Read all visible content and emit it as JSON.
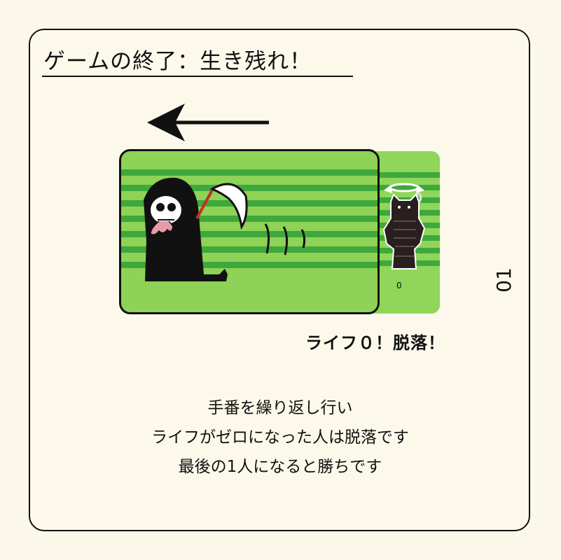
{
  "title": "ゲームの終了：生き残れ！",
  "caption": "ライフ０！脱落！",
  "page_number": "01",
  "body": {
    "lines": [
      "手番を繰り返し行い",
      "ライフがゼロになった人は脱落です",
      "最後の1人になると勝ちです"
    ]
  },
  "colors": {
    "background": "#fbf8e9",
    "card_green": "#8ed257",
    "card_stripe": "#3fa83c",
    "ink": "#111111"
  },
  "icons": {
    "arrow": "arrow-left-icon",
    "reaper": "grim-reaper-illustration",
    "spirit": "ghost-angel-illustration"
  }
}
